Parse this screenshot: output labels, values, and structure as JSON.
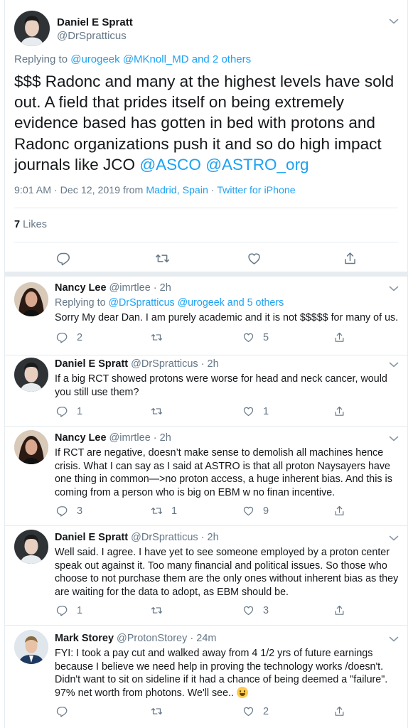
{
  "main_tweet": {
    "author_name": "Daniel E Spratt",
    "author_handle": "@DrSpratticus",
    "replying_prefix": "Replying to ",
    "replying_to": "@urogeek @MKnoll_MD and 2 others",
    "text_prefix": "$$$ Radonc and many at the highest levels have sold out. A field that prides itself on being extremely evidence based has gotten in bed with protons and Radonc organizations push it and so do high impact journals like JCO ",
    "mention1": "@ASCO",
    "mention2": "@ASTRO_org",
    "time": "9:01 AM · Dec 12, 2019 from ",
    "location": "Madrid, Spain",
    "separator": " · ",
    "source": "Twitter for iPhone",
    "likes_count": "7",
    "likes_label": " Likes"
  },
  "replies": [
    {
      "author_name": "Nancy Lee",
      "author_handle": "@imrtlee",
      "time": " · 2h",
      "replying_prefix": "Replying to ",
      "replying_to": "@DrSpratticus @urogeek and 5 others",
      "text": "Sorry My dear Dan.  I am purely academic and it is not $$$$$ for many of us.",
      "reply_count": "2",
      "retweet_count": "",
      "like_count": "5"
    },
    {
      "author_name": "Daniel E Spratt",
      "author_handle": "@DrSpratticus",
      "time": " · 2h",
      "text": "If a big RCT showed protons were worse for head and neck cancer, would you still use them?",
      "reply_count": "1",
      "retweet_count": "",
      "like_count": "1"
    },
    {
      "author_name": "Nancy Lee",
      "author_handle": "@imrtlee",
      "time": " · 2h",
      "text": "If RCT are negative, doesn’t make sense to demolish all machines hence crisis. What I can say as I said at ASTRO is that all proton Naysayers have one thing in common—>no proton access, a huge inherent bias. And this is coming from a person who is big on EBM w no finan incentive.",
      "reply_count": "3",
      "retweet_count": "1",
      "like_count": "9"
    },
    {
      "author_name": "Daniel E Spratt",
      "author_handle": "@DrSpratticus",
      "time": " · 2h",
      "text": "Well said. I agree. I have yet to see someone employed by a proton center speak out against it. Too many financial and political issues. So those who choose to not purchase them are the only ones without inherent bias as they are waiting for the data to adopt, as EBM should be.",
      "reply_count": "1",
      "retweet_count": "",
      "like_count": "3"
    },
    {
      "author_name": "Mark Storey",
      "author_handle": "@ProtonStorey",
      "time": " · 24m",
      "text": "FYI: I took a pay cut and walked away from 4 1/2 yrs of future earnings because I believe we need help in proving the technology works /doesn't. Didn't want to sit on sideline if it had a chance of being deemed a \"failure\". 97% net worth from photons. We'll see.. ",
      "emoji": "grinning-face-emoji",
      "reply_count": "",
      "retweet_count": "",
      "like_count": "2"
    }
  ],
  "colors": {
    "accent": "#1da1f2",
    "secondary_text": "#657786",
    "primary_text": "#14171a",
    "border": "#e6ecf0"
  }
}
